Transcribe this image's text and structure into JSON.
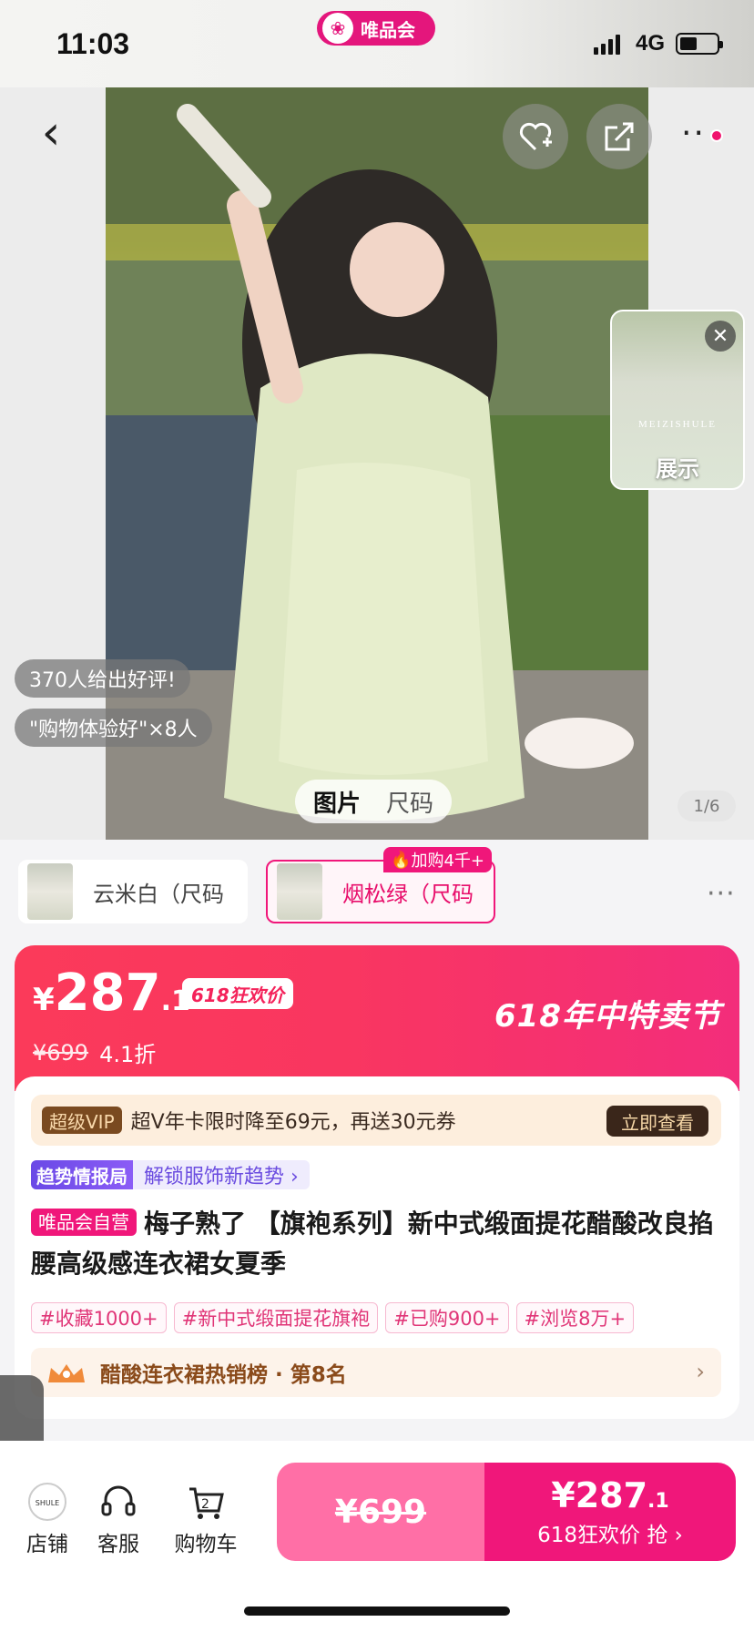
{
  "status": {
    "time": "11:03",
    "network": "4G",
    "brand": "唯品会"
  },
  "hero": {
    "review_count": "370人给出好评!",
    "review_quote": "\"购物体验好\"×8人",
    "tabs": [
      "图片",
      "尺码"
    ],
    "counter": "1/6",
    "float_brand": "MEIZISHULE",
    "float_label": "展示",
    "float_close": "✕"
  },
  "variants": {
    "items": [
      {
        "label": "云米白（尺码"
      },
      {
        "label": "烟松绿（尺码",
        "badge": "加购4千+"
      }
    ],
    "more": "···"
  },
  "price": {
    "symbol": "¥",
    "integer": "287",
    "decimal": ".1",
    "tag": "618狂欢价",
    "original": "¥699",
    "discount": "4.1折",
    "festival": "618年中特卖节"
  },
  "vip": {
    "chip": "超级VIP",
    "text": "超V年卡限时降至69元，再送30元券",
    "button": "立即查看"
  },
  "trend": {
    "chip": "趋势情报局",
    "link": "解锁服饰新趋势 ›"
  },
  "product": {
    "self_tag": "唯品会自营",
    "title": "梅子熟了 【旗袍系列】新中式缎面提花醋酸改良掐腰高级感连衣裙女夏季",
    "tags": [
      "#收藏1000+",
      "#新中式缎面提花旗袍",
      "#已购900+",
      "#浏览8万+"
    ]
  },
  "rank": {
    "text": "醋酸连衣裙热销榜 · 第8名",
    "arrow": "›"
  },
  "bottom": {
    "store_label": "店铺",
    "service_label": "客服",
    "cart_label": "购物车",
    "cart_count": "2",
    "buy_original": "¥699",
    "buy_price_int": "¥287",
    "buy_price_dec": ".1",
    "buy_sub": "618狂欢价 抢 ›"
  },
  "colors": {
    "accent": "#f0177a",
    "price_red": "#fb3a5a"
  }
}
